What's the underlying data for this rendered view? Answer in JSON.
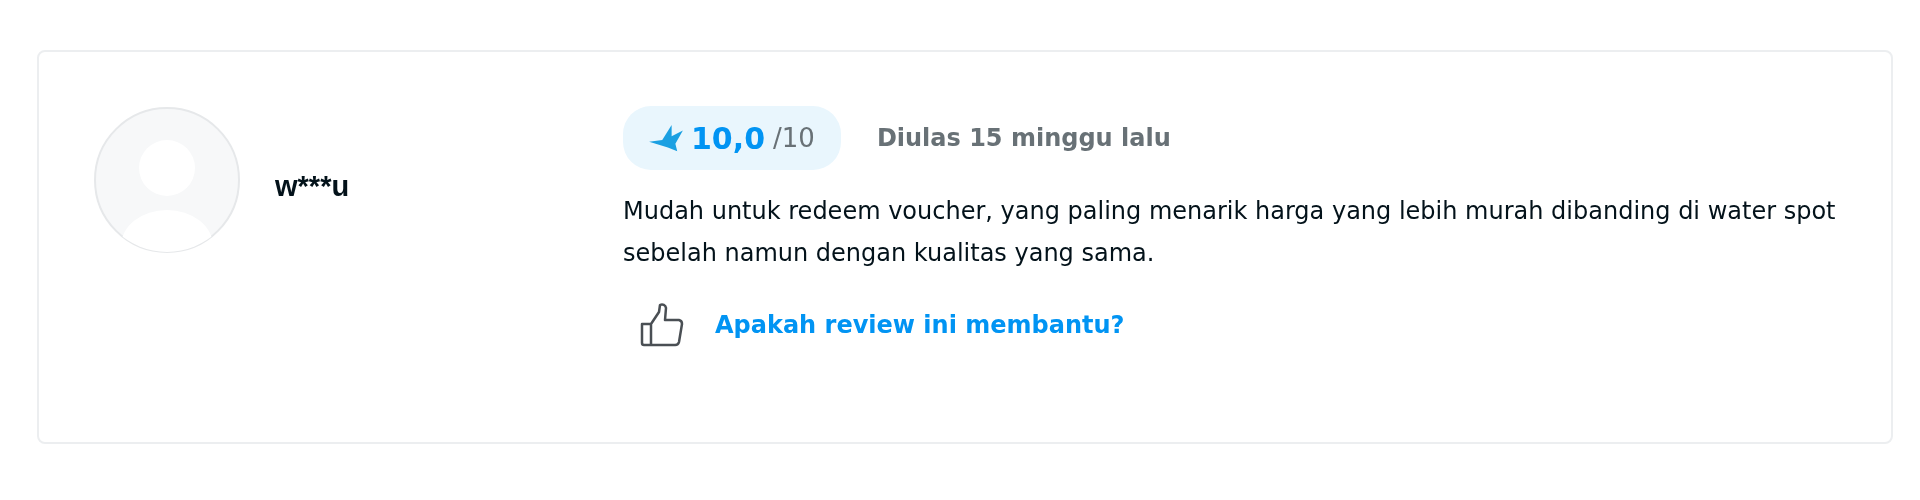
{
  "review": {
    "reviewer": {
      "name": "w***u"
    },
    "rating": {
      "score": "10,0",
      "scale": "/10"
    },
    "date": "Diulas 15 minggu lalu",
    "text": "Mudah untuk redeem voucher, yang paling menarik harga yang lebih murah dibanding di water spot sebelah namun dengan kualitas yang sama.",
    "helpful_link": "Apakah review ini membantu?"
  }
}
